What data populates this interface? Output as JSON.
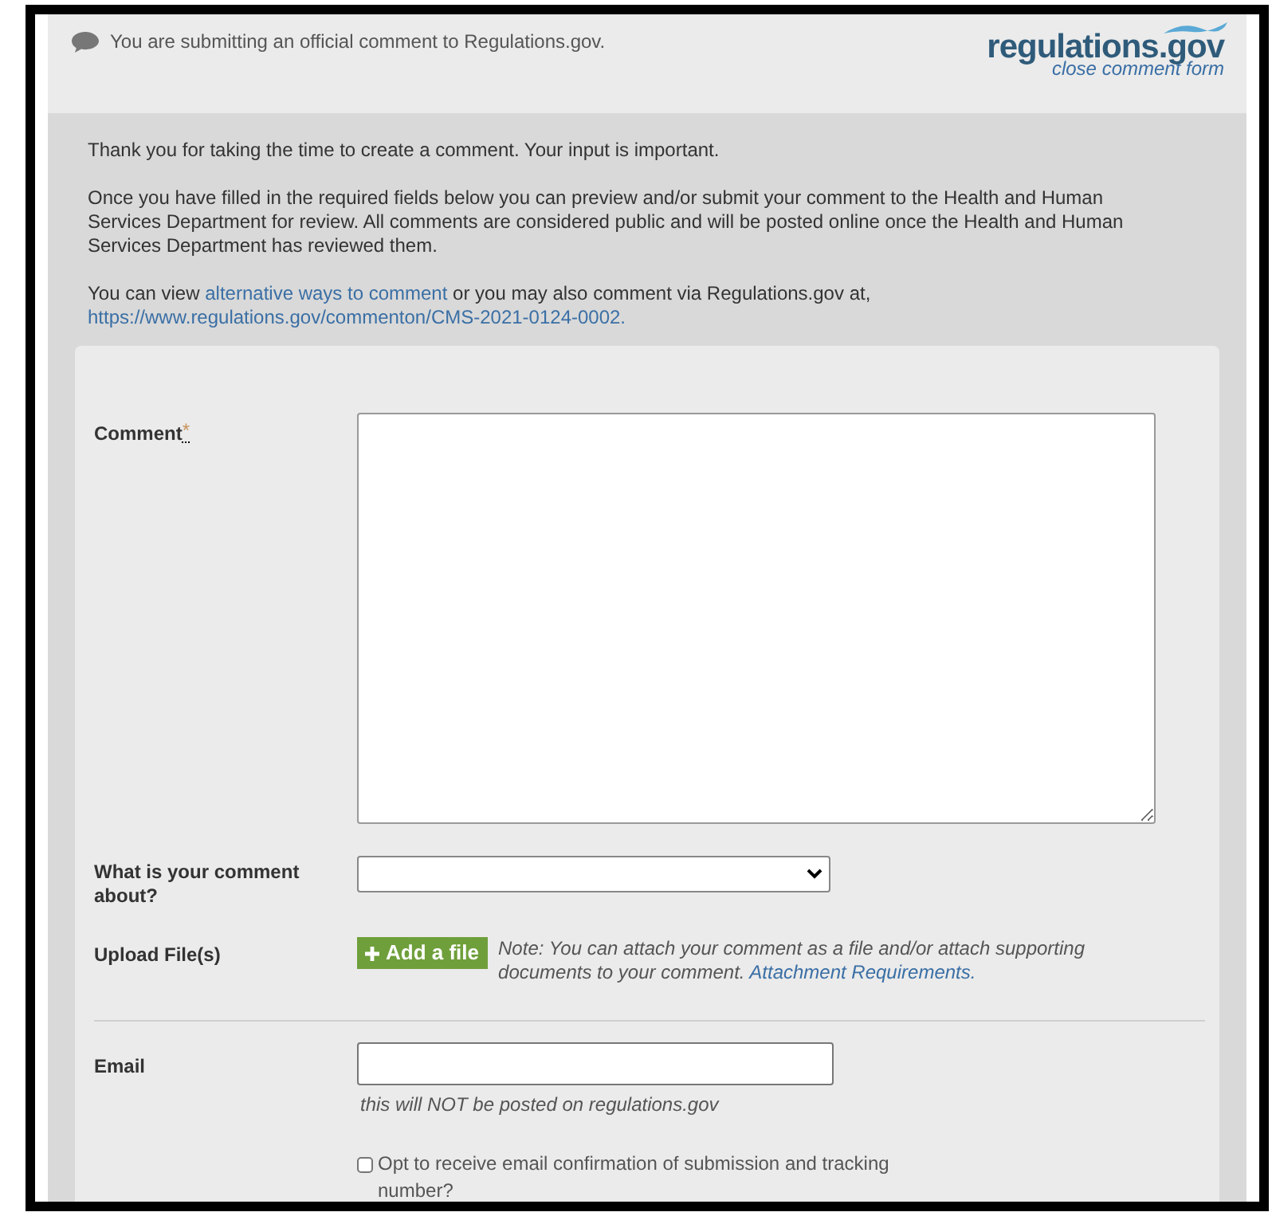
{
  "header": {
    "message": "You are submitting an official comment to Regulations.gov.",
    "logo": "regulations.gov",
    "close_link": "close comment form"
  },
  "intro": {
    "thanks": "Thank you for taking the time to create a comment. Your input is important.",
    "instructions": "Once you have filled in the required fields below you can preview and/or submit your comment to the Health and Human Services Department for review. All comments are considered public and will be posted online once the Health and Human Services Department has reviewed them.",
    "alt_before": "You can view",
    "alt_link": "alternative ways to comment",
    "alt_after": "or you may also comment via Regulations.gov at,",
    "url_link": "https://www.regulations.gov/commenton/CMS-2021-0124-0002."
  },
  "form": {
    "comment": {
      "label": "Comment",
      "required_mark": "*"
    },
    "topic": {
      "label": "What is your comment about?"
    },
    "upload": {
      "label": "Upload File(s)",
      "button": "Add a file",
      "note": "Note: You can attach your comment as a file and/or attach supporting documents to your comment.",
      "note_link": "Attachment Requirements."
    },
    "email": {
      "label": "Email",
      "hint": "this will NOT be posted on regulations.gov"
    },
    "confirm": {
      "label": "Opt to receive email confirmation of submission and tracking number?",
      "checked": false
    }
  }
}
